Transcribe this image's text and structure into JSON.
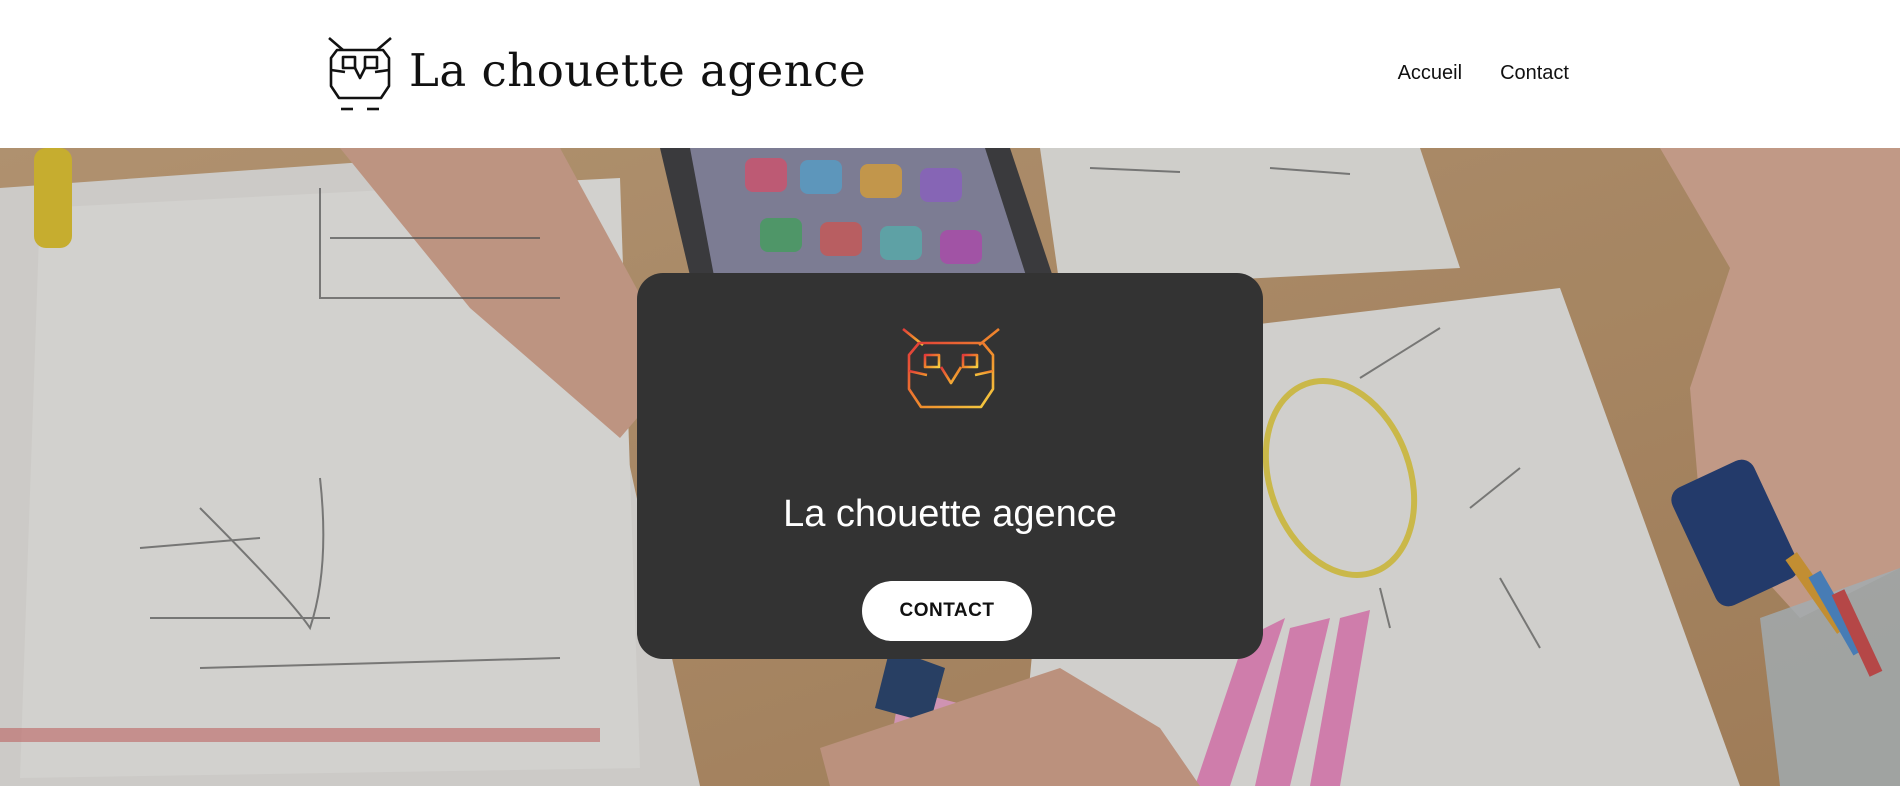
{
  "header": {
    "brand_name": "La chouette agence",
    "nav": [
      {
        "label": "Accueil"
      },
      {
        "label": "Contact"
      }
    ]
  },
  "hero": {
    "title": "La chouette agence",
    "button_label": "CONTACT",
    "background_image": "hands sketching wireframes on paper with smartphone and highlighters"
  },
  "colors": {
    "card_background": "#333333",
    "logo_gradient_start": "#e23a3a",
    "logo_gradient_end": "#f5c542",
    "button_background": "#ffffff",
    "header_background": "#ffffff"
  },
  "icons": {
    "brand_logo": "owl-icon",
    "card_logo": "owl-gradient-icon"
  }
}
